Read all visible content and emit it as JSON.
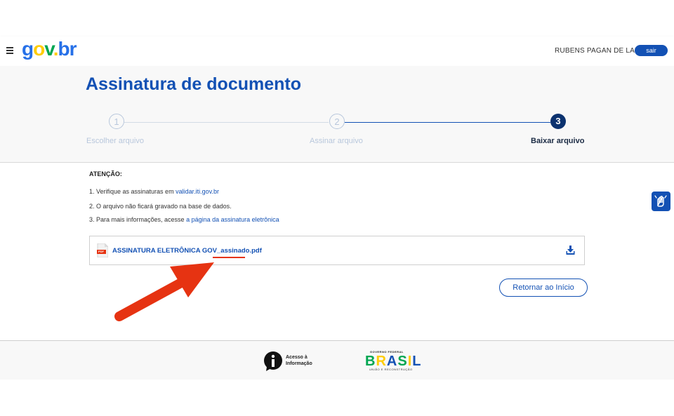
{
  "header": {
    "logo": [
      "g",
      "o",
      "v",
      ".",
      "b",
      "r"
    ],
    "logo_colors": [
      "#2670e8",
      "#ffcd07",
      "#00a651",
      "#2670e8",
      "#2670e8",
      "#2670e8"
    ],
    "user_name": "RUBENS PAGAN DE LARA",
    "logout_label": "sair"
  },
  "page": {
    "title": "Assinatura de documento"
  },
  "steps": [
    {
      "number": "1",
      "label": "Escolher arquivo",
      "state": "done"
    },
    {
      "number": "2",
      "label": "Assinar arquivo",
      "state": "done"
    },
    {
      "number": "3",
      "label": "Baixar arquivo",
      "state": "active"
    }
  ],
  "notice": {
    "heading": "ATENÇÃO:",
    "item1_text": "1. Verifique as assinaturas em ",
    "item1_link": "validar.iti.gov.br",
    "item2_text": "2. O arquivo não ficará gravado na base de dados.",
    "item3_text": "3. Para mais informações, acesse ",
    "item3_link": "a página da assinatura eletrônica"
  },
  "file": {
    "name": "ASSINATURA ELETRÔNICA GOV_assinado.pdf",
    "icon": "pdf-file-icon",
    "pdf_badge": "PDF",
    "download_icon": "download-icon"
  },
  "actions": {
    "return_label": "Retornar ao Início"
  },
  "footer": {
    "acesso_line1": "Acesso à",
    "acesso_line2": "Informação",
    "gov_federal": "GOVERNO FEDERAL",
    "brasil_letters": [
      "B",
      "R",
      "A",
      "S",
      "I",
      "L"
    ],
    "brasil_colors": [
      "#00a651",
      "#ffcd07",
      "#1351b4",
      "#00a651",
      "#ffcd07",
      "#1351b4"
    ],
    "uniao": "UNIÃO E RECONSTRUÇÃO"
  },
  "colors": {
    "primary": "#1351b4",
    "arrow": "#e63312",
    "step_inactive": "#b8c7dc"
  }
}
